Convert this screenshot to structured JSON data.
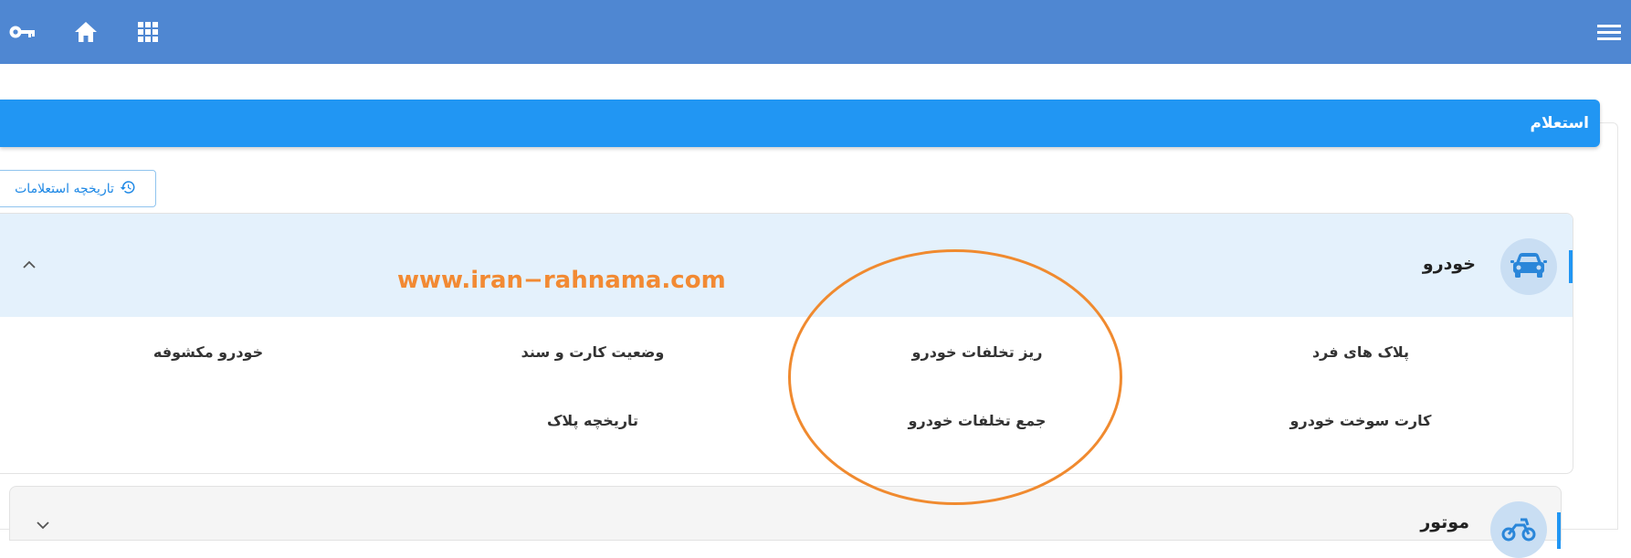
{
  "page": {
    "section_title": "استعلام",
    "history_button_label": "تاریخچه استعلامات",
    "watermark": "www.iran−rahnama.com"
  },
  "topbar": {
    "icons": [
      "key-icon",
      "home-icon",
      "apps-grid-icon",
      "menu-icon"
    ]
  },
  "groups": [
    {
      "title": "خودرو",
      "icon": "car-icon",
      "expanded": true,
      "services": [
        "پلاک های فرد",
        "ریز تخلفات خودرو",
        "وضعیت کارت و سند",
        "خودرو مکشوفه",
        "کارت سوخت خودرو",
        "جمع تخلفات خودرو",
        "تاریخچه پلاک"
      ]
    },
    {
      "title": "موتور",
      "icon": "motorcycle-icon",
      "expanded": false
    }
  ],
  "colors": {
    "topbar": "#4f87d2",
    "title_bar": "#2196f3",
    "group_header": "#e4f1fc",
    "annotation": "#f08a2f",
    "watermark": "#f28a33"
  }
}
